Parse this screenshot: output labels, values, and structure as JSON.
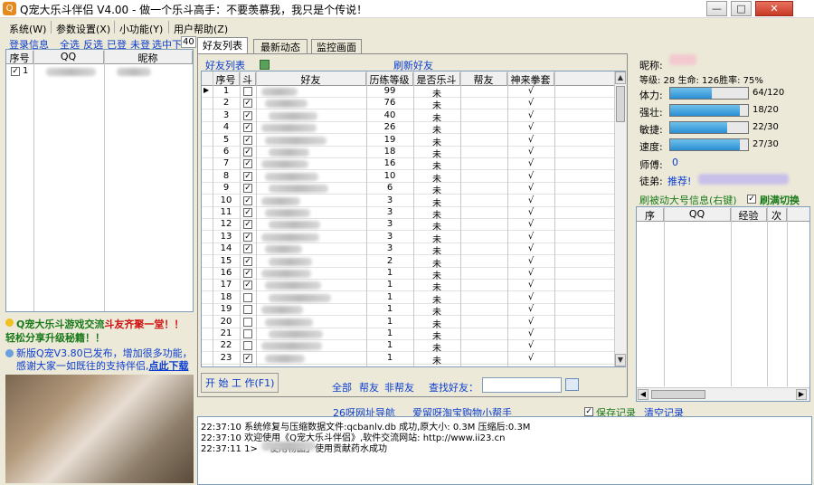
{
  "window": {
    "title": "Q宠大乐斗伴侣 V4.00 - 做一个乐斗高手：不要羡慕我，我只是个传说！",
    "logo": "Q",
    "minimize": "—",
    "maximize": "□",
    "close": "✕"
  },
  "menu": [
    "系统(W)",
    "参数设置(X)",
    "小功能(Y)",
    "用户帮助(Z)"
  ],
  "login": {
    "legend": "登录信息",
    "select_all": "全选",
    "invert": "反选",
    "logged": "已登",
    "not_selected": "未登",
    "select_mid": "选中下",
    "count": "40",
    "col_no": "序号",
    "col_qq": "QQ",
    "col_nick": "昵称",
    "row_no": "1"
  },
  "promo": {
    "line1a": "Q宠大乐斗游戏交流",
    "line1b": "斗友齐聚一堂！！",
    "line2": "轻松分享升级秘籍！！",
    "news_a": "新版Q宠V3.80已发布，增加很多功能，感谢大家一如既往的支持伴侣,",
    "news_link": "点此下载"
  },
  "tabs": [
    "好友列表",
    "最新动态",
    "监控画面"
  ],
  "friends": {
    "legend": "好友列表",
    "refresh": "刷新好友",
    "cols": [
      "序号",
      "斗",
      "好友",
      "历练等级",
      "是否乐斗",
      "帮友",
      "神来拳套"
    ],
    "rows": [
      {
        "no": "1",
        "chk": false,
        "lv": "99",
        "fight": "未",
        "glove": "√"
      },
      {
        "no": "2",
        "chk": true,
        "lv": "76",
        "fight": "未",
        "glove": "√"
      },
      {
        "no": "3",
        "chk": true,
        "lv": "40",
        "fight": "未",
        "glove": "√"
      },
      {
        "no": "4",
        "chk": true,
        "lv": "26",
        "fight": "未",
        "glove": "√"
      },
      {
        "no": "5",
        "chk": true,
        "lv": "19",
        "fight": "未",
        "glove": "√"
      },
      {
        "no": "6",
        "chk": true,
        "lv": "18",
        "fight": "未",
        "glove": "√"
      },
      {
        "no": "7",
        "chk": true,
        "lv": "16",
        "fight": "未",
        "glove": "√"
      },
      {
        "no": "8",
        "chk": true,
        "lv": "10",
        "fight": "未",
        "glove": "√"
      },
      {
        "no": "9",
        "chk": true,
        "lv": "6",
        "fight": "未",
        "glove": "√"
      },
      {
        "no": "10",
        "chk": true,
        "lv": "3",
        "fight": "未",
        "glove": "√"
      },
      {
        "no": "11",
        "chk": true,
        "lv": "3",
        "fight": "未",
        "glove": "√"
      },
      {
        "no": "12",
        "chk": true,
        "lv": "3",
        "fight": "未",
        "glove": "√"
      },
      {
        "no": "13",
        "chk": true,
        "lv": "3",
        "fight": "未",
        "glove": "√"
      },
      {
        "no": "14",
        "chk": true,
        "lv": "3",
        "fight": "未",
        "glove": "√"
      },
      {
        "no": "15",
        "chk": true,
        "lv": "2",
        "fight": "未",
        "glove": "√"
      },
      {
        "no": "16",
        "chk": true,
        "lv": "1",
        "fight": "未",
        "glove": "√"
      },
      {
        "no": "17",
        "chk": true,
        "lv": "1",
        "fight": "未",
        "glove": "√"
      },
      {
        "no": "18",
        "chk": false,
        "lv": "1",
        "fight": "未",
        "glove": "√"
      },
      {
        "no": "19",
        "chk": false,
        "lv": "1",
        "fight": "未",
        "glove": "√"
      },
      {
        "no": "20",
        "chk": false,
        "lv": "1",
        "fight": "未",
        "glove": "√"
      },
      {
        "no": "21",
        "chk": false,
        "lv": "1",
        "fight": "未",
        "glove": "√"
      },
      {
        "no": "22",
        "chk": false,
        "lv": "1",
        "fight": "未",
        "glove": "√"
      },
      {
        "no": "23",
        "chk": true,
        "lv": "1",
        "fight": "未",
        "glove": "√"
      }
    ],
    "start_btn": "开 始 工 作(F1)",
    "all": "全部",
    "friend": "帮友",
    "nonfriend": "非帮友",
    "search_label": "查找好友："
  },
  "stats": {
    "nick_label": "昵称:",
    "level_line": "等级: 28 生命: 126胜率: 75%",
    "bars": [
      {
        "label": "体力:",
        "text": "64/120",
        "pct": 53
      },
      {
        "label": "强壮:",
        "text": "18/20",
        "pct": 90
      },
      {
        "label": "敏捷:",
        "text": "22/30",
        "pct": 73
      },
      {
        "label": "速度:",
        "text": "27/30",
        "pct": 90
      }
    ],
    "master_label": "师傅:",
    "master_value": "0",
    "apprentice_label": "徒弟:",
    "apprentice_value": "推荐!"
  },
  "big_acct": {
    "legend": "刷被动大号信息(右键)",
    "check_label": "刷满切换",
    "cols": [
      "序",
      "QQ",
      "经验",
      "次"
    ]
  },
  "links": {
    "nav": "26呀网址导航",
    "shop": "爱留呀淘宝购物小帮手",
    "save_log": "保存记录",
    "clear_log": "清空记录"
  },
  "log": [
    "22:37:10  系统修复与压缩数据文件:qcbanlv.db 成功,原大小: 0.3M 压缩后:0.3M",
    "22:37:10  欢迎使用《Q宠大乐斗伴侣》,软件交流网站: http://www.ii23.cn",
    "22:37:11  1>                    「使用物品」使用贡献药水成功"
  ]
}
